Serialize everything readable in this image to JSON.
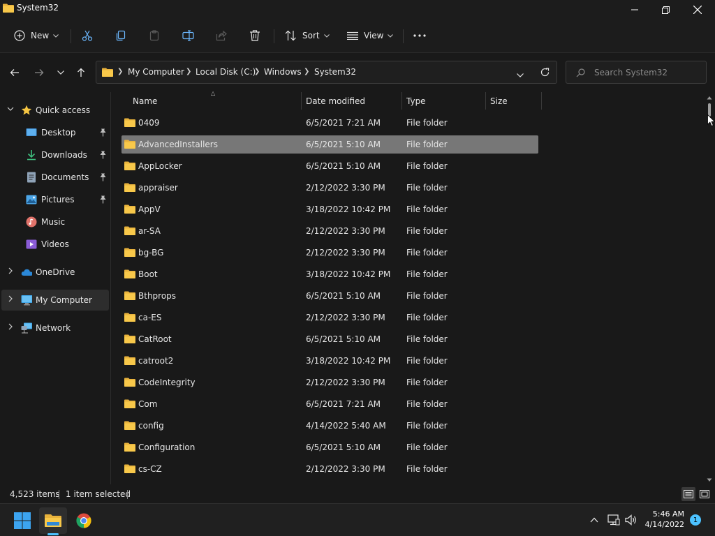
{
  "window": {
    "title": "System32"
  },
  "toolbar": {
    "new_label": "New",
    "sort_label": "Sort",
    "view_label": "View"
  },
  "address": {
    "crumbs": [
      "My Computer",
      "Local Disk (C:)",
      "Windows",
      "System32"
    ]
  },
  "search": {
    "placeholder": "Search System32"
  },
  "sidebar": {
    "quick_access": "Quick access",
    "items": [
      {
        "label": "Desktop",
        "icon": "desktop-icon",
        "pinned": true
      },
      {
        "label": "Downloads",
        "icon": "downloads-icon",
        "pinned": true
      },
      {
        "label": "Documents",
        "icon": "documents-icon",
        "pinned": true
      },
      {
        "label": "Pictures",
        "icon": "pictures-icon",
        "pinned": true
      },
      {
        "label": "Music",
        "icon": "music-icon",
        "pinned": false
      },
      {
        "label": "Videos",
        "icon": "videos-icon",
        "pinned": false
      }
    ],
    "onedrive": "OneDrive",
    "my_computer": "My Computer",
    "network": "Network"
  },
  "columns": {
    "name": "Name",
    "date": "Date modified",
    "type": "Type",
    "size": "Size"
  },
  "files": [
    {
      "name": "0409",
      "date": "6/5/2021 7:21 AM",
      "type": "File folder"
    },
    {
      "name": "AdvancedInstallers",
      "date": "6/5/2021 5:10 AM",
      "type": "File folder",
      "selected": true
    },
    {
      "name": "AppLocker",
      "date": "6/5/2021 5:10 AM",
      "type": "File folder"
    },
    {
      "name": "appraiser",
      "date": "2/12/2022 3:30 PM",
      "type": "File folder"
    },
    {
      "name": "AppV",
      "date": "3/18/2022 10:42 PM",
      "type": "File folder"
    },
    {
      "name": "ar-SA",
      "date": "2/12/2022 3:30 PM",
      "type": "File folder"
    },
    {
      "name": "bg-BG",
      "date": "2/12/2022 3:30 PM",
      "type": "File folder"
    },
    {
      "name": "Boot",
      "date": "3/18/2022 10:42 PM",
      "type": "File folder"
    },
    {
      "name": "Bthprops",
      "date": "6/5/2021 5:10 AM",
      "type": "File folder"
    },
    {
      "name": "ca-ES",
      "date": "2/12/2022 3:30 PM",
      "type": "File folder"
    },
    {
      "name": "CatRoot",
      "date": "6/5/2021 5:10 AM",
      "type": "File folder"
    },
    {
      "name": "catroot2",
      "date": "3/18/2022 10:42 PM",
      "type": "File folder"
    },
    {
      "name": "CodeIntegrity",
      "date": "2/12/2022 3:30 PM",
      "type": "File folder"
    },
    {
      "name": "Com",
      "date": "6/5/2021 7:21 AM",
      "type": "File folder"
    },
    {
      "name": "config",
      "date": "4/14/2022 5:40 AM",
      "type": "File folder"
    },
    {
      "name": "Configuration",
      "date": "6/5/2021 5:10 AM",
      "type": "File folder"
    },
    {
      "name": "cs-CZ",
      "date": "2/12/2022 3:30 PM",
      "type": "File folder"
    }
  ],
  "status": {
    "item_count": "4,523 items",
    "selection": "1 item selected"
  },
  "taskbar": {
    "time": "5:46 AM",
    "date": "4/14/2022",
    "notifications": "1"
  },
  "colors": {
    "folder": "#f8c84a",
    "accent": "#4cc2ff",
    "selected_row": "#777777"
  }
}
